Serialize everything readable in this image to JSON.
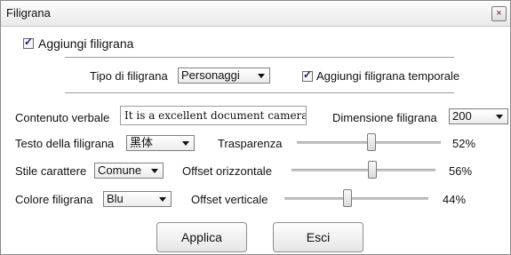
{
  "window": {
    "title": "Filigrana",
    "close_glyph": "×"
  },
  "add_watermark": {
    "label": "Aggiungi filigrana",
    "checked": true
  },
  "watermark_type": {
    "label": "Tipo di filigrana",
    "value": "Personaggi"
  },
  "add_time_watermark": {
    "label": "Aggiungi filigrana temporale",
    "checked": true
  },
  "verbal_content": {
    "label": "Contenuto verbale",
    "value": "It is a excellent document camera"
  },
  "watermark_size": {
    "label": "Dimensione filigrana",
    "value": "200"
  },
  "watermark_text": {
    "label": "Testo della filigrana",
    "value": "黑体"
  },
  "transparency": {
    "label": "Trasparenza",
    "value": "52%",
    "fraction": 0.52
  },
  "char_style": {
    "label": "Stile carattere",
    "value": "Comune"
  },
  "offset_horizontal": {
    "label": "Offset orizzontale",
    "value": "56%",
    "fraction": 0.56
  },
  "watermark_color": {
    "label": "Colore filigrana",
    "value": "Blu"
  },
  "offset_vertical": {
    "label": "Offset verticale",
    "value": "44%",
    "fraction": 0.44
  },
  "buttons": {
    "apply": "Applica",
    "exit": "Esci"
  },
  "icons": {
    "close": "close-icon",
    "dropdown": "chevron-down-icon",
    "check": "checkmark-icon"
  }
}
